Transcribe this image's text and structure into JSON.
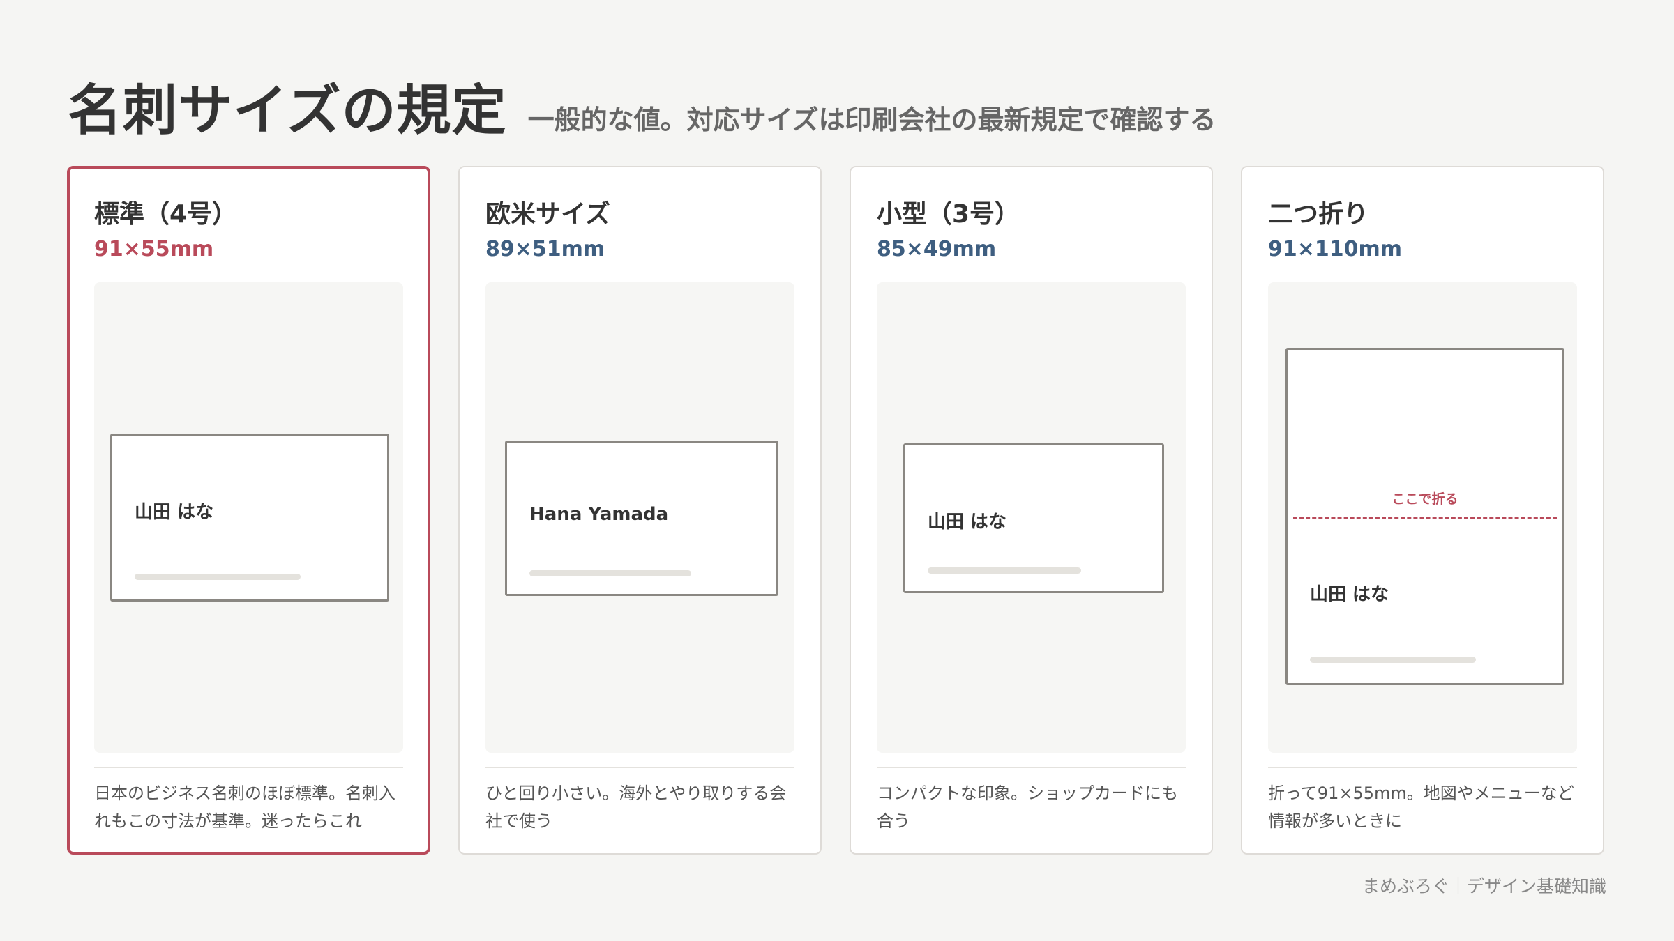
{
  "header": {
    "title": "名刺サイズの規定",
    "subtitle": "一般的な値。対応サイズは印刷会社の最新規定で確認する"
  },
  "cards": [
    {
      "name": "標準（4号）",
      "size": "91×55mm",
      "card_text": "山田 はな",
      "description": "日本のビジネス名刺のほぼ標準。名刺入れもこの寸法が基準。迷ったらこれ"
    },
    {
      "name": "欧米サイズ",
      "size": "89×51mm",
      "card_text": "Hana Yamada",
      "description": "ひと回り小さい。海外とやり取りする会社で使う"
    },
    {
      "name": "小型（3号）",
      "size": "85×49mm",
      "card_text": "山田 はな",
      "description": "コンパクトな印象。ショップカードにも合う"
    },
    {
      "name": "二つ折り",
      "size": "91×110mm",
      "card_text": "山田 はな",
      "fold_label": "ここで折る",
      "description": "折って91×55mm。地図やメニューなど情報が多いときに"
    }
  ],
  "footer": "まめぶろぐ｜デザイン基礎知識",
  "colors": {
    "accent": "#b94a5a",
    "size_text": "#3e5e80",
    "background": "#f5f5f3"
  }
}
